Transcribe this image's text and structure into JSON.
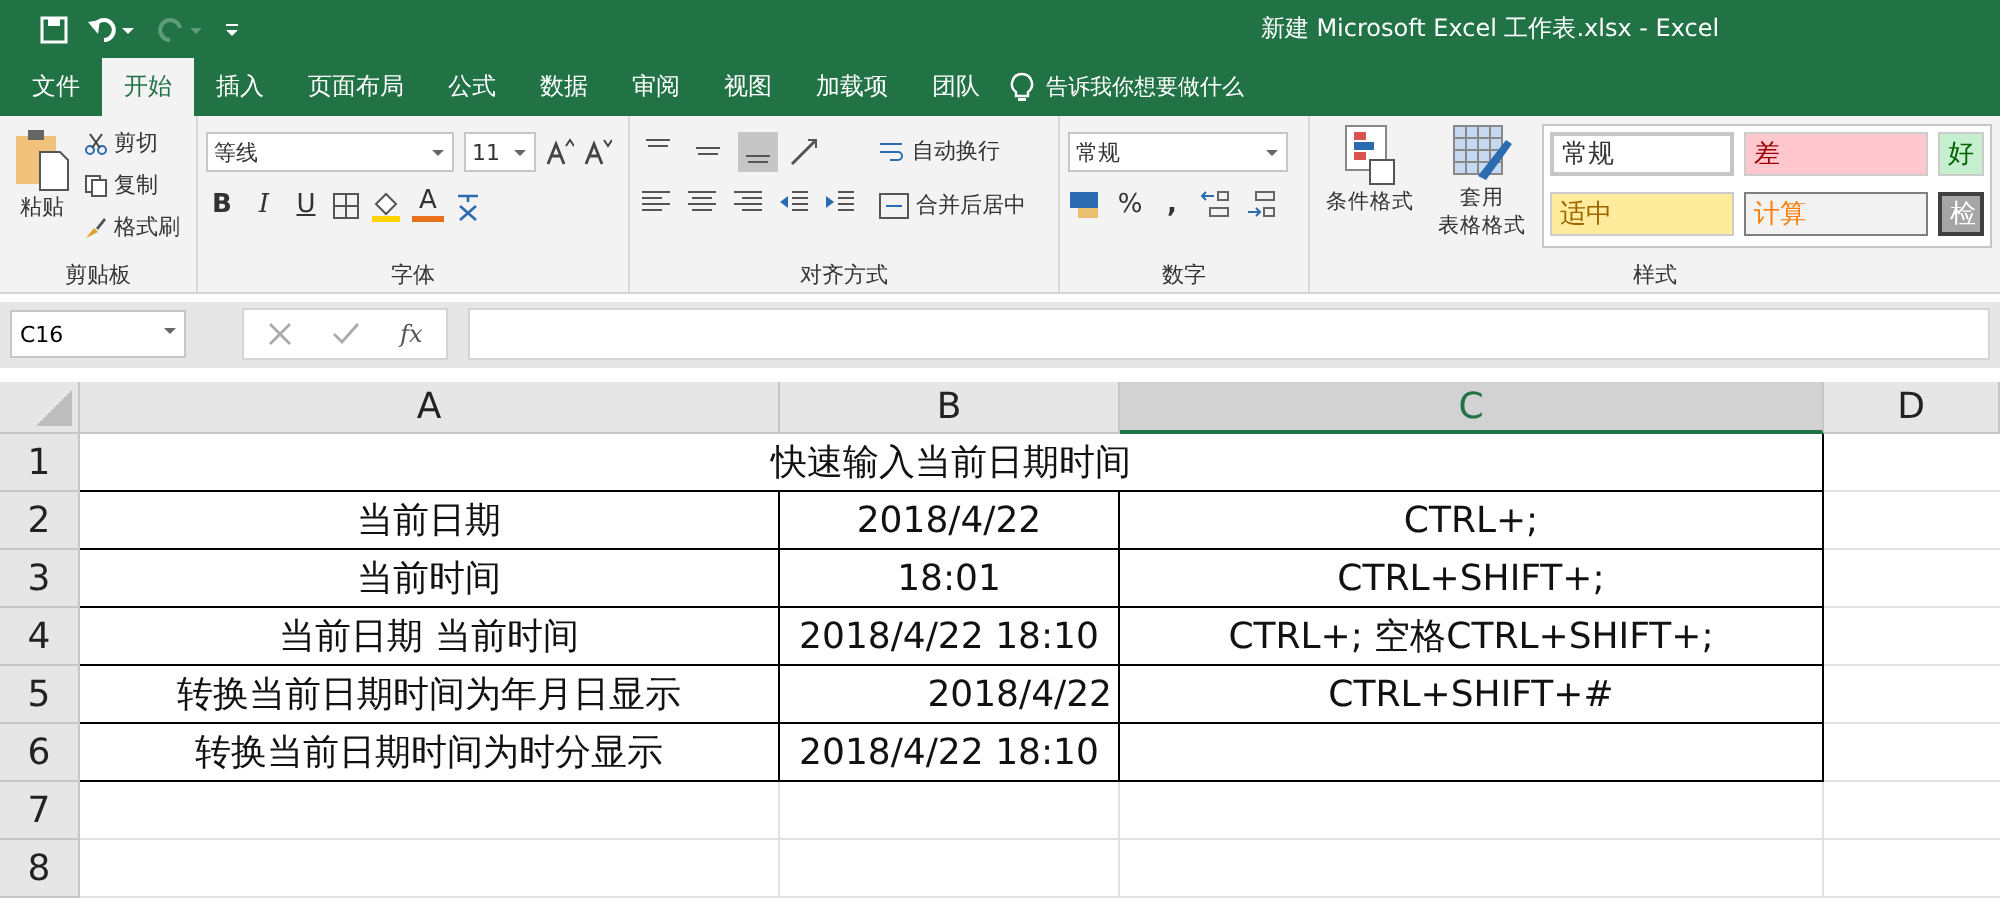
{
  "window": {
    "title": "新建 Microsoft Excel 工作表.xlsx  -  Excel"
  },
  "menu_tabs": [
    {
      "label": "文件",
      "selected": false
    },
    {
      "label": "开始",
      "selected": true
    },
    {
      "label": "插入",
      "selected": false
    },
    {
      "label": "页面布局",
      "selected": false
    },
    {
      "label": "公式",
      "selected": false
    },
    {
      "label": "数据",
      "selected": false
    },
    {
      "label": "审阅",
      "selected": false
    },
    {
      "label": "视图",
      "selected": false
    },
    {
      "label": "加载项",
      "selected": false
    },
    {
      "label": "团队",
      "selected": false
    }
  ],
  "tell_me": {
    "placeholder": "告诉我你想要做什么"
  },
  "ribbon": {
    "clipboard": {
      "paste": "粘贴",
      "cut": "剪切",
      "copy": "复制",
      "format_painter": "格式刷",
      "label": "剪贴板"
    },
    "font": {
      "font_name": "等线",
      "font_size": "11",
      "bold": "B",
      "italic": "I",
      "underline": "U",
      "font_color": "A",
      "label": "字体"
    },
    "alignment": {
      "align_buttons": [
        {
          "selected": false
        },
        {
          "selected": false
        },
        {
          "selected": true
        }
      ],
      "wrap_text": "自动换行",
      "merge_center": "合并后居中",
      "label": "对齐方式"
    },
    "number": {
      "format": "常规",
      "percent": "%",
      "comma": ",",
      "label": "数字"
    },
    "styles": {
      "conditional_formatting": "条件格式",
      "format_as_table": [
        "套用",
        "表格格式"
      ],
      "cell_styles": [
        {
          "label": "常规",
          "color": "#ffffff"
        },
        {
          "label": "差",
          "color": "#ffc7ce"
        },
        {
          "label": "好",
          "color": "#c6efce"
        },
        {
          "label": "适中",
          "color": "#ffeb9c"
        },
        {
          "label": "计算",
          "color": "#f2f2f2"
        },
        {
          "label": "检",
          "color": "#a5a5a5"
        }
      ],
      "label": "样式"
    }
  },
  "formula_bar": {
    "name_box": "C16",
    "fx": "fx"
  },
  "sheet": {
    "columns": [
      {
        "label": "A",
        "selected": false
      },
      {
        "label": "B",
        "selected": false
      },
      {
        "label": "C",
        "selected": true
      },
      {
        "label": "D",
        "selected": false
      }
    ],
    "rows": [
      {
        "number": "1",
        "title": "快速输入当前日期时间"
      },
      {
        "number": "2",
        "cells": [
          {
            "text": "当前日期"
          },
          {
            "text": "2018/4/22"
          },
          {
            "text": "CTRL+;"
          }
        ]
      },
      {
        "number": "3",
        "cells": [
          {
            "text": "当前时间"
          },
          {
            "text": "18:01"
          },
          {
            "text": "CTRL+SHIFT+;"
          }
        ]
      },
      {
        "number": "4",
        "cells": [
          {
            "text": "当前日期 当前时间"
          },
          {
            "text": "2018/4/22 18:10"
          },
          {
            "text": "CTRL+; 空格CTRL+SHIFT+;"
          }
        ]
      },
      {
        "number": "5",
        "cells": [
          {
            "text": "转换当前日期时间为年月日显示"
          },
          {
            "text": "2018/4/22",
            "right_aligned": true
          },
          {
            "text": "CTRL+SHIFT+#"
          }
        ]
      },
      {
        "number": "6",
        "cells": [
          {
            "text": "转换当前日期时间为时分显示"
          },
          {
            "text": "2018/4/22 18:10"
          },
          {}
        ]
      },
      {
        "number": "7"
      },
      {
        "number": "8"
      }
    ]
  }
}
